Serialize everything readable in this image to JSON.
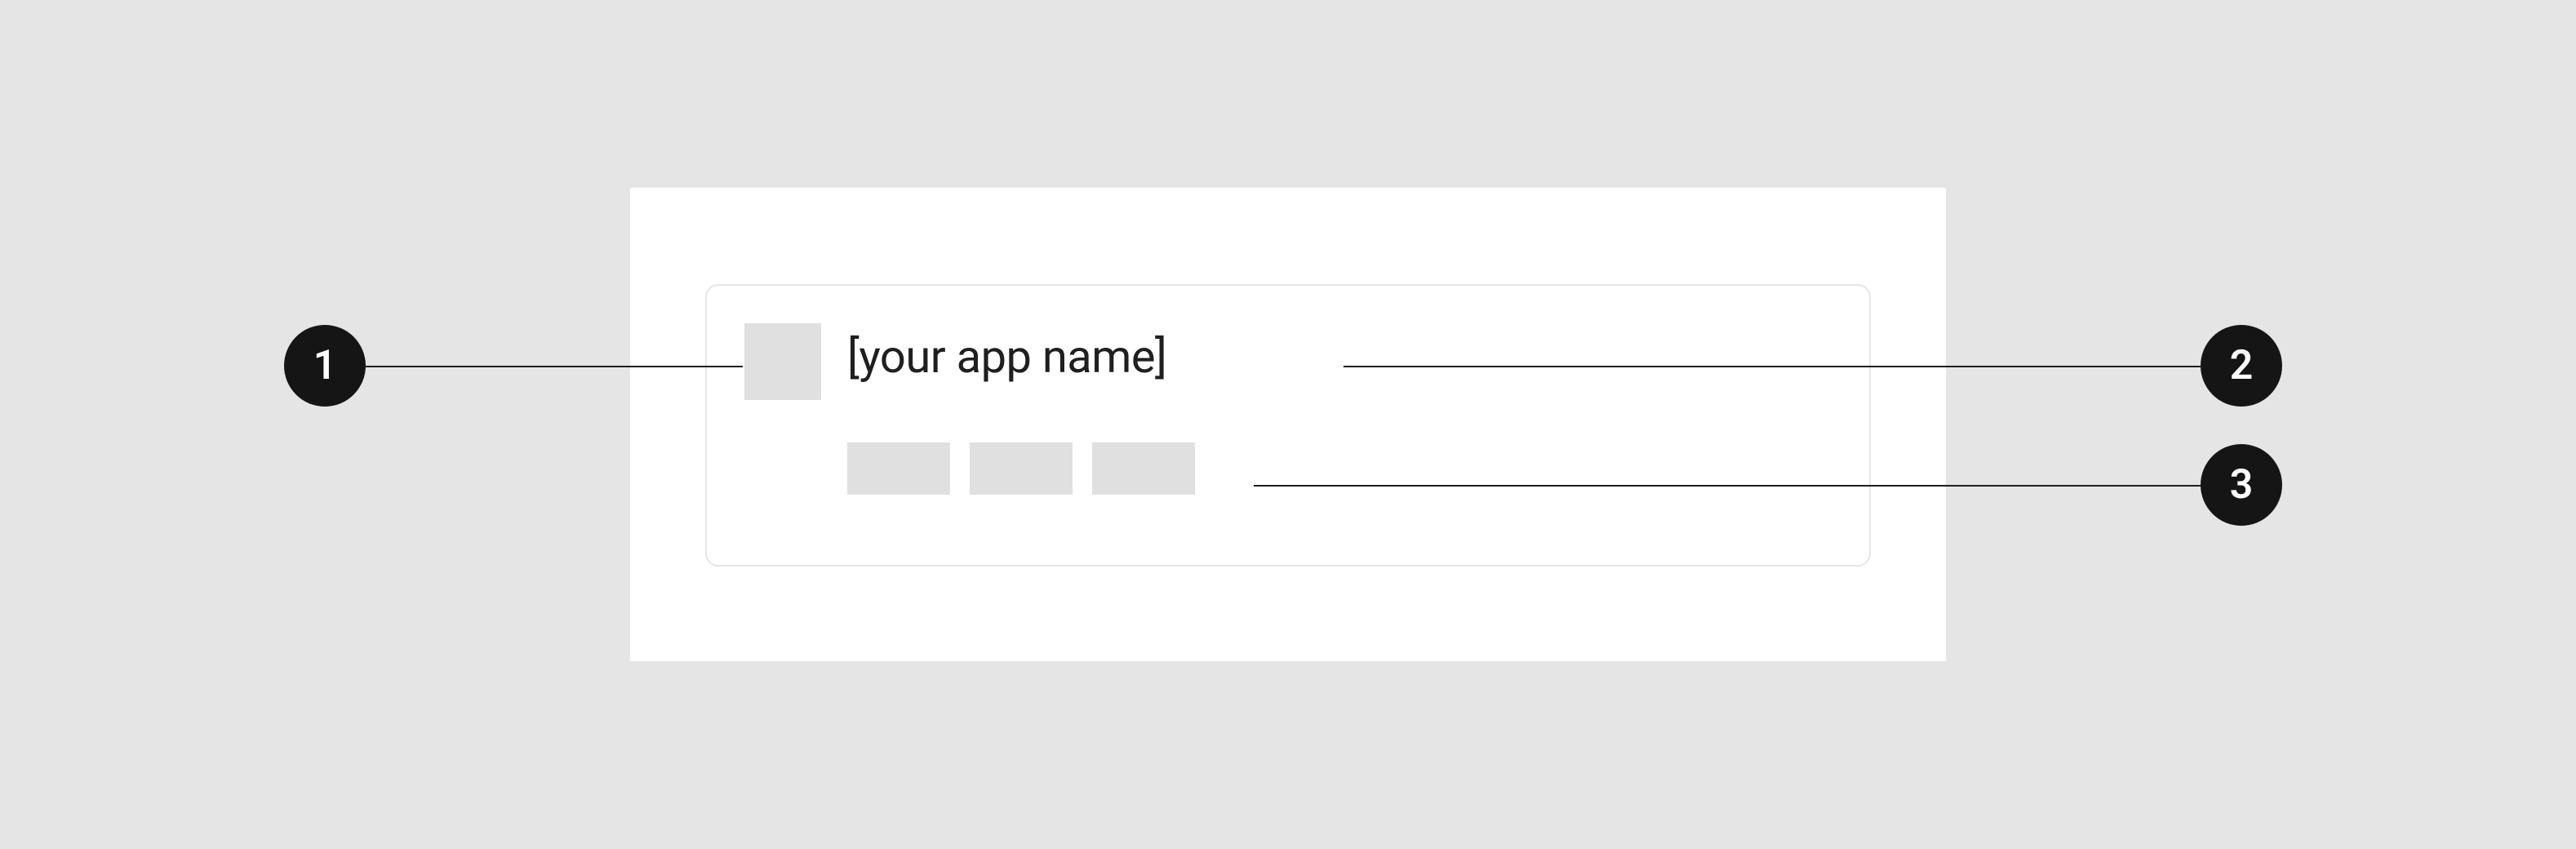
{
  "callouts": {
    "c1": "1",
    "c2": "2",
    "c3": "3"
  },
  "card": {
    "app_name": "[your app name]"
  }
}
